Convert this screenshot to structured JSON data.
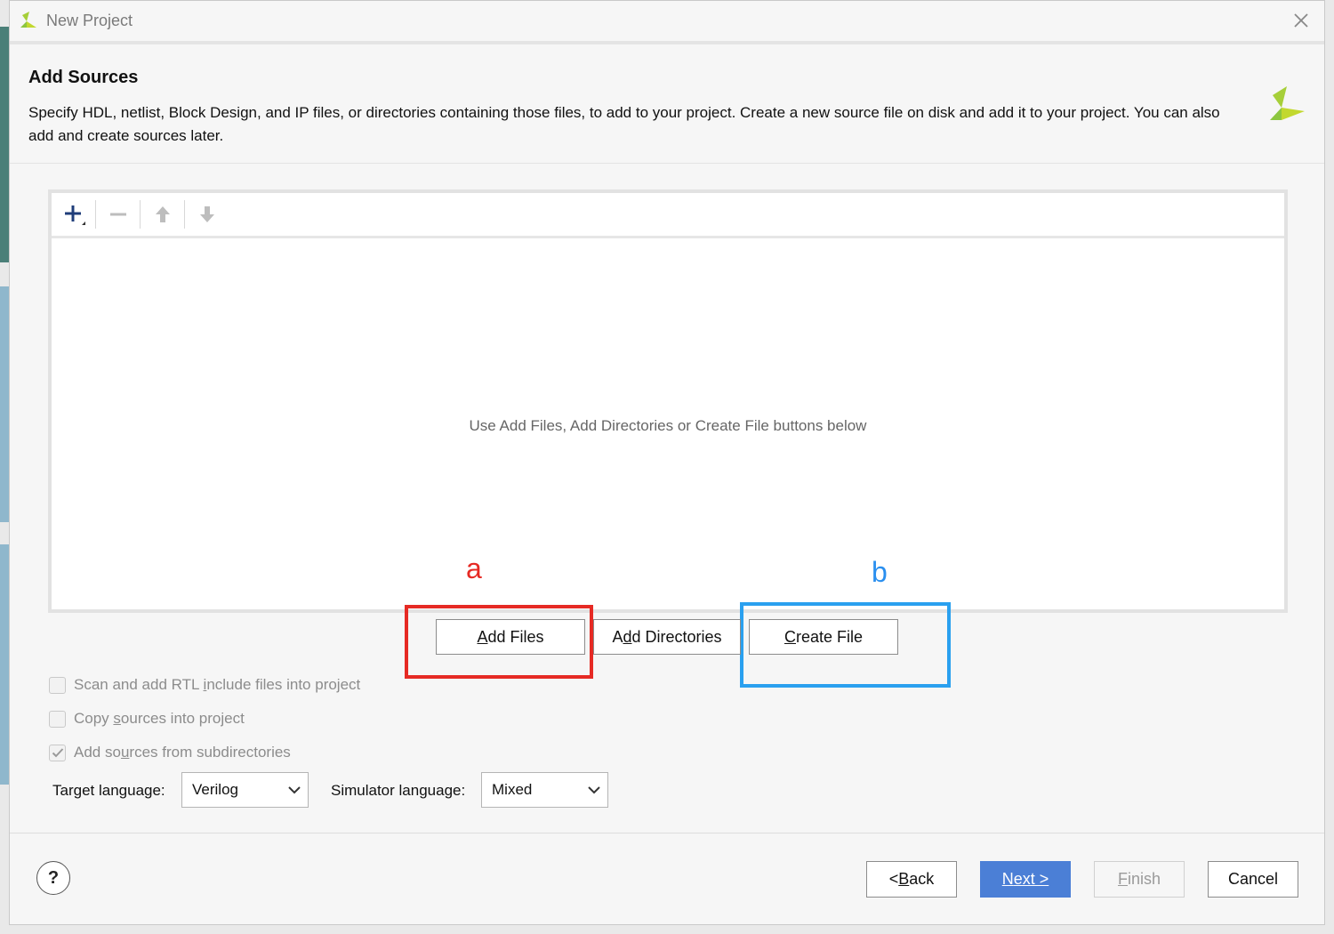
{
  "window": {
    "title": "New Project",
    "logo_icon": "xilinx-logo-icon",
    "close_icon": "close-icon"
  },
  "header": {
    "title": "Add Sources",
    "description": "Specify HDL, netlist, Block Design, and IP files, or directories containing those files, to add to your project. Create a new source file on disk and add it to your project. You can also add and create sources later."
  },
  "toolbar": {
    "add_icon": "plus-icon",
    "remove_icon": "minus-icon",
    "up_icon": "arrow-up-icon",
    "down_icon": "arrow-down-icon"
  },
  "file_list": {
    "empty_hint": "Use Add Files, Add Directories or Create File buttons below"
  },
  "buttons": {
    "add_files": {
      "pre": "",
      "mnemonic": "A",
      "post": "dd Files"
    },
    "add_directories": {
      "pre": "A",
      "mnemonic": "d",
      "post": "d Directories"
    },
    "create_file": {
      "pre": "",
      "mnemonic": "C",
      "post": "reate File"
    }
  },
  "annotations": {
    "a": "a",
    "b": "b",
    "a_color": "#e62a24",
    "b_color": "#2aa0ef"
  },
  "options": {
    "scan_rtl": {
      "pre": "Scan and add RTL ",
      "mnemonic": "i",
      "post": "nclude files into project",
      "checked": false
    },
    "copy_sources": {
      "pre": "Copy ",
      "mnemonic": "s",
      "post": "ources into project",
      "checked": false
    },
    "add_subdirs": {
      "pre": "Add so",
      "mnemonic": "u",
      "post": "rces from subdirectories",
      "checked": true
    }
  },
  "languages": {
    "target_label": "Target language:",
    "target_value": "Verilog",
    "simulator_label": "Simulator language:",
    "simulator_value": "Mixed"
  },
  "footer": {
    "help": "?",
    "back": {
      "pre": "< ",
      "mnemonic": "B",
      "post": "ack"
    },
    "next": {
      "pre": "",
      "mnemonic": "N",
      "post": "ext >"
    },
    "finish": {
      "pre": "",
      "mnemonic": "F",
      "post": "inish"
    },
    "cancel": "Cancel",
    "next_color": "#4b7fd6"
  }
}
